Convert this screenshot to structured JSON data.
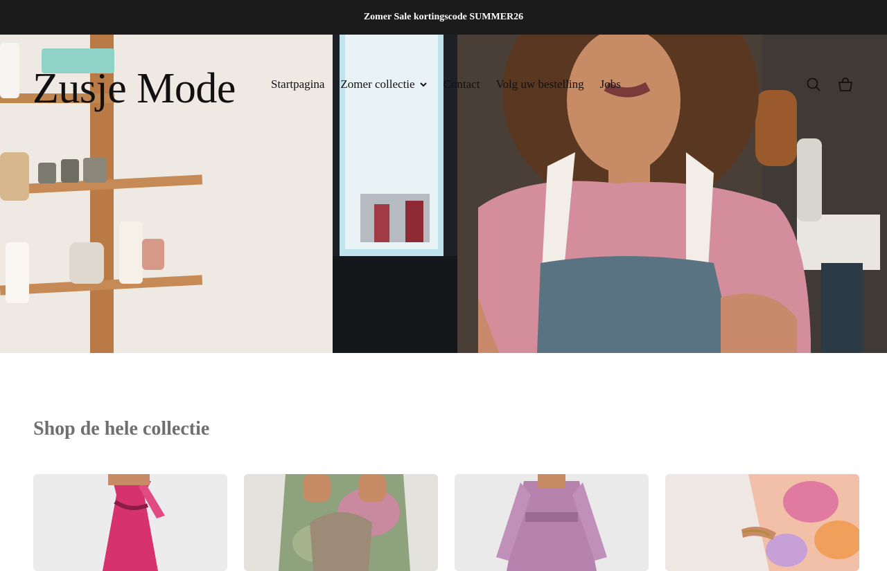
{
  "announcement": {
    "text": "Zomer Sale kortingscode SUMMER26"
  },
  "header": {
    "logo": "Zusje Mode",
    "nav": [
      {
        "label": "Startpagina"
      },
      {
        "label": "Zomer collectie",
        "has_dropdown": true
      },
      {
        "label": "Contact"
      },
      {
        "label": "Volg uw bestelling"
      },
      {
        "label": "Jobs"
      }
    ],
    "icons": [
      "search-icon",
      "cart-icon"
    ]
  },
  "hero": {
    "image": "shop-owner-photo"
  },
  "collection": {
    "title": "Shop de hele collectie",
    "products": [
      {
        "image": "pink-floral-halter-dress"
      },
      {
        "image": "green-tie-dye-maxi-dress"
      },
      {
        "image": "lilac-square-neck-dress"
      },
      {
        "image": "pastel-floral-chiffon-dress"
      }
    ]
  },
  "colors": {
    "announcement_bg": "#1b1b1b",
    "announcement_text": "#ffffff",
    "section_title": "#6f6f6f"
  }
}
